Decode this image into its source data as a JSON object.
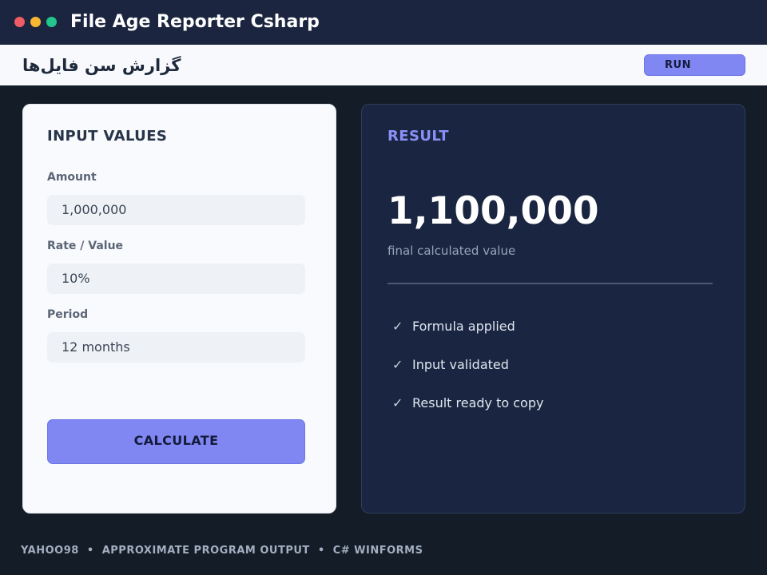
{
  "window": {
    "title": "File Age Reporter Csharp",
    "controls": [
      "close",
      "minimize",
      "maximize"
    ]
  },
  "header": {
    "subtitle": "گزارش سن فایل‌ها",
    "run_label": "RUN"
  },
  "input_panel": {
    "title": "INPUT VALUES",
    "fields": [
      {
        "label": "Amount",
        "value": "1,000,000"
      },
      {
        "label": "Rate / Value",
        "value": "10%"
      },
      {
        "label": "Period",
        "value": "12 months"
      }
    ],
    "calculate_label": "CALCULATE"
  },
  "result_panel": {
    "title": "RESULT",
    "value": "1,100,000",
    "caption": "final calculated value",
    "checks": [
      {
        "icon": "check-icon",
        "mark": "✓",
        "label": "Formula applied"
      },
      {
        "icon": "check-icon",
        "mark": "✓",
        "label": "Input validated"
      },
      {
        "icon": "check-icon",
        "mark": "✓",
        "label": "Result ready to copy"
      }
    ]
  },
  "footer": {
    "text": "YAHOO98  •  APPROXIMATE PROGRAM OUTPUT  •  C# WINFORMS"
  },
  "colors": {
    "accent": "#8087f2",
    "titlebar": "#1c2540",
    "background": "#131c27",
    "result_panel": "#1a2641",
    "close": "#f05c64",
    "minimize": "#f7b731",
    "maximize": "#22c58b"
  }
}
